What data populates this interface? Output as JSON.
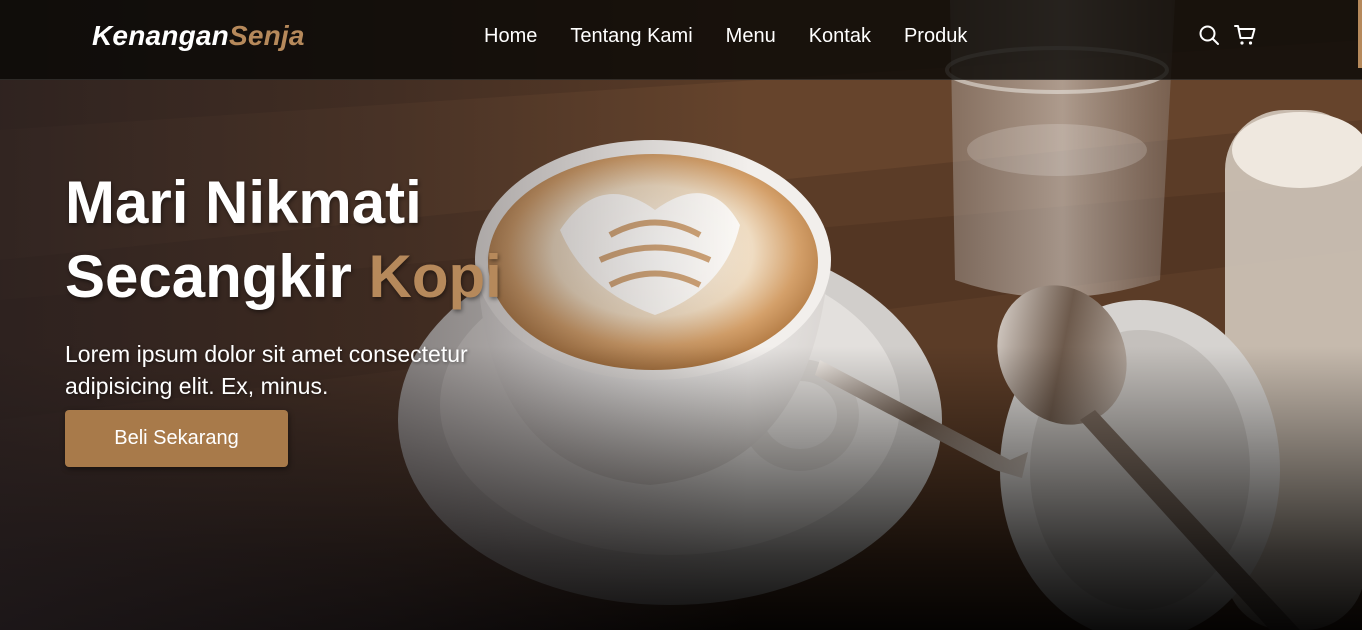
{
  "brand": {
    "part1": "Kenangan",
    "part2": "Senja"
  },
  "nav": {
    "links": [
      "Home",
      "Tentang Kami",
      "Menu",
      "Kontak",
      "Produk"
    ],
    "icons": [
      "search-icon",
      "shopping-cart-icon"
    ]
  },
  "hero": {
    "title_line1": "Mari Nikmati",
    "title_line2_a": "Secangkir",
    "title_line2_b": "Kopi",
    "description": "Lorem ipsum dolor sit amet consectetur adipisicing elit. Ex, minus.",
    "cta_label": "Beli Sekarang"
  },
  "colors": {
    "accent": "#b6895b",
    "button": "#a87a4a",
    "navbar": "#0a0806",
    "text": "#ffffff"
  }
}
